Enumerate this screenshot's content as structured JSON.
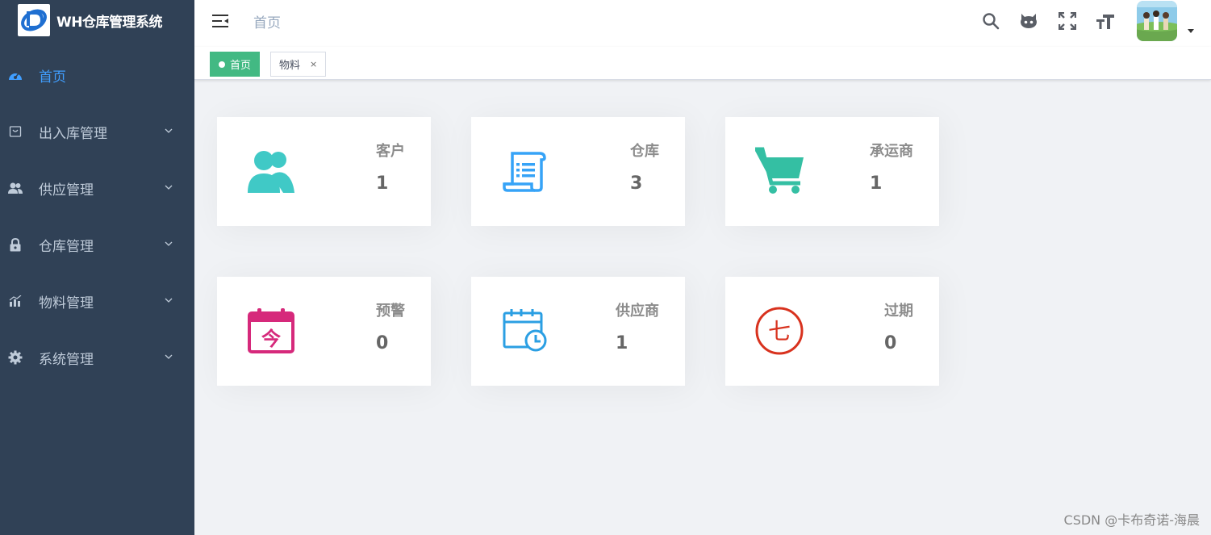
{
  "app": {
    "title": "WH仓库管理系统"
  },
  "sidebar": {
    "items": [
      {
        "label": "首页",
        "icon": "dashboard-icon",
        "active": true
      },
      {
        "label": "出入库管理",
        "icon": "shopping-bag-icon"
      },
      {
        "label": "供应管理",
        "icon": "peoples-icon"
      },
      {
        "label": "仓库管理",
        "icon": "lock-icon"
      },
      {
        "label": "物料管理",
        "icon": "chart-icon"
      },
      {
        "label": "系统管理",
        "icon": "gear-icon"
      }
    ]
  },
  "navbar": {
    "breadcrumb": "首页",
    "icons": [
      "search-icon",
      "github-icon",
      "fullscreen-icon",
      "font-size-icon"
    ]
  },
  "tags": [
    {
      "label": "首页",
      "active": true
    },
    {
      "label": "物料",
      "close": "×"
    }
  ],
  "cards": [
    {
      "label": "客户",
      "value": "1",
      "icon": "users-icon",
      "color": "#40c9c6"
    },
    {
      "label": "仓库",
      "value": "3",
      "icon": "scroll-list-icon",
      "color": "#36a3f7"
    },
    {
      "label": "承运商",
      "value": "1",
      "icon": "cart-icon",
      "color": "#34bfa3"
    },
    {
      "label": "预警",
      "value": "0",
      "icon": "calendar-today-icon",
      "color": "#d6297b"
    },
    {
      "label": "供应商",
      "value": "1",
      "icon": "calendar-clock-icon",
      "color": "#2b9fe3"
    },
    {
      "label": "过期",
      "value": "0",
      "icon": "seven-circle-icon",
      "color": "#d8321e"
    }
  ],
  "watermark": "CSDN @卡布奇诺-海晨",
  "colors": {
    "sidebar_bg": "#304156",
    "active": "#409eff",
    "tag_active": "#42b983"
  }
}
